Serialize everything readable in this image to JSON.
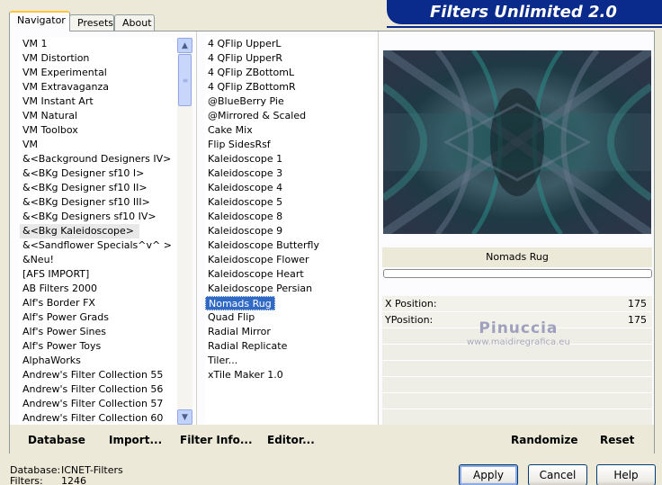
{
  "tabs": [
    "Navigator",
    "Presets",
    "About"
  ],
  "brand_title": "Filters Unlimited 2.0",
  "categories": [
    "VM 1",
    "VM Distortion",
    "VM Experimental",
    "VM Extravaganza",
    "VM Instant Art",
    "VM Natural",
    "VM Toolbox",
    "VM",
    "&<Background Designers IV>",
    "&<BKg Designer sf10 I>",
    "&<BKg Designer sf10 II>",
    "&<BKg Designer sf10 III>",
    "&<BKg Designers sf10 IV>",
    "&<Bkg Kaleidoscope>",
    "&<Sandflower Specials^v^ >",
    "&Neu!",
    "[AFS IMPORT]",
    "AB Filters 2000",
    "Alf's Border FX",
    "Alf's Power Grads",
    "Alf's Power Sines",
    "Alf's Power Toys",
    "AlphaWorks",
    "Andrew's Filter Collection 55",
    "Andrew's Filter Collection 56",
    "Andrew's Filter Collection 57",
    "Andrew's Filter Collection 60"
  ],
  "selected_category": "&<Bkg Kaleidoscope>",
  "filters": [
    "4 QFlip UpperL",
    "4 QFlip UpperR",
    "4 QFlip ZBottomL",
    "4 QFlip ZBottomR",
    "@BlueBerry Pie",
    "@Mirrored & Scaled",
    "Cake Mix",
    "Flip SidesRsf",
    "Kaleidoscope 1",
    "Kaleidoscope 3",
    "Kaleidoscope 4",
    "Kaleidoscope 5",
    "Kaleidoscope 8",
    "Kaleidoscope 9",
    "Kaleidoscope Butterfly",
    "Kaleidoscope Flower",
    "Kaleidoscope Heart",
    "Kaleidoscope Persian",
    "Nomads Rug",
    "Quad Flip",
    "Radial Mirror",
    "Radial Replicate",
    "Tiler...",
    "xTile Maker 1.0"
  ],
  "selected_filter": "Nomads Rug",
  "filter_name": "Nomads Rug",
  "params": [
    {
      "label": "X Position:",
      "value": "175"
    },
    {
      "label": "YPosition:",
      "value": "175"
    }
  ],
  "watermark": {
    "line1": "Pinuccia",
    "line2": "www.maidiregrafica.eu"
  },
  "bottom_links": {
    "database": "Database",
    "import": "Import...",
    "filter_info": "Filter Info...",
    "editor": "Editor...",
    "randomize": "Randomize",
    "reset": "Reset"
  },
  "status": {
    "database_label": "Database:",
    "database_value": "ICNET-Filters",
    "filters_label": "Filters:",
    "filters_value": "1246"
  },
  "buttons": {
    "apply": "Apply",
    "cancel": "Cancel",
    "help": "Help"
  },
  "colors": {
    "brand": "#0a2a8c",
    "selection": "#316ac5",
    "tab_accent": "#ffc83c"
  },
  "icons": {
    "scroll_up": "chevron-up-icon",
    "scroll_down": "chevron-down-icon"
  }
}
